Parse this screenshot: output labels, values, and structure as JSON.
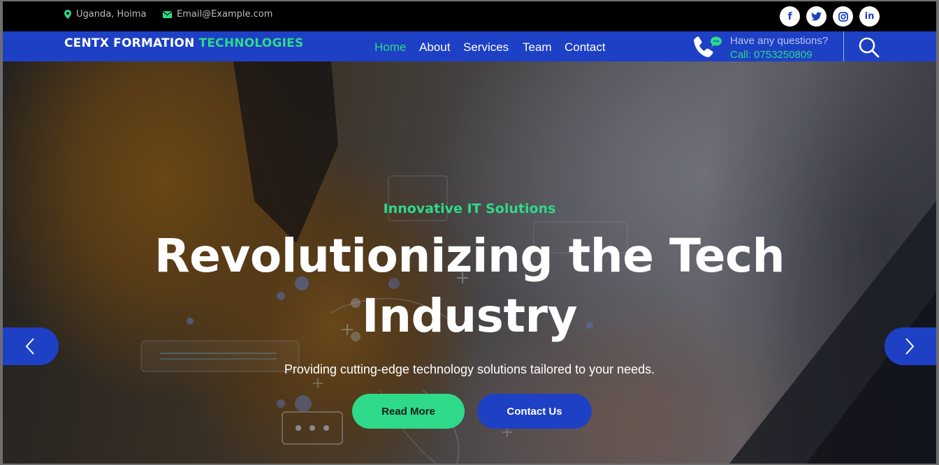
{
  "topbar": {
    "location": "Uganda, Hoima",
    "email": "Email@Example.com",
    "social": [
      {
        "name": "facebook",
        "glyph": "f"
      },
      {
        "name": "twitter",
        "glyph": "t"
      },
      {
        "name": "instagram",
        "glyph": "◎"
      },
      {
        "name": "linkedin",
        "glyph": "in"
      }
    ]
  },
  "nav": {
    "brand_part1": "CENTX FORMATION",
    "brand_part2": "TECHNOLOGIES",
    "items": [
      {
        "label": "Home",
        "active": true
      },
      {
        "label": "About",
        "active": false
      },
      {
        "label": "Services",
        "active": false
      },
      {
        "label": "Team",
        "active": false
      },
      {
        "label": "Contact",
        "active": false
      }
    ],
    "questions_label": "Have any questions?",
    "call_label": "Call: 0753250809"
  },
  "hero": {
    "tagline": "Innovative IT Solutions",
    "headline_line1": "Revolutionizing the Tech",
    "headline_line2": "Industry",
    "subtitle": "Providing cutting-edge technology solutions tailored to your needs.",
    "read_more": "Read More",
    "contact_us": "Contact Us"
  },
  "colors": {
    "primary": "#1d40c4",
    "accent": "#2fd98a",
    "topbar": "#000000"
  },
  "icons": {
    "location": "map-pin-icon",
    "email": "envelope-icon",
    "phone": "phone-chat-icon",
    "search": "search-icon",
    "prev": "chevron-left-icon",
    "next": "chevron-right-icon"
  }
}
